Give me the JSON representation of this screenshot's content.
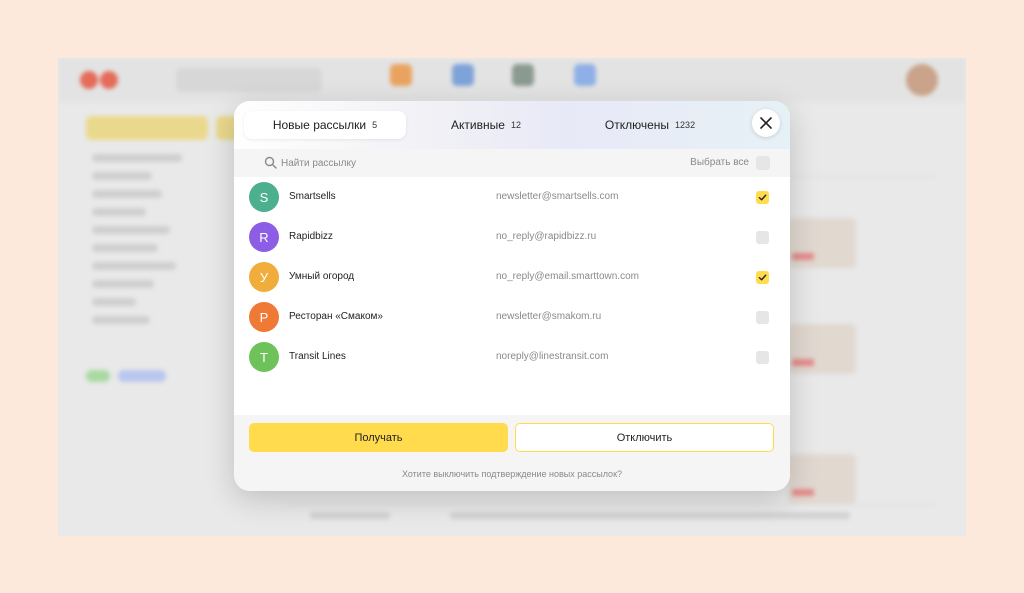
{
  "colors": {
    "page_bg": "#fde9db",
    "accent": "#ffdb4d",
    "muted_text": "#8a8a8a",
    "avatar_teal": "#4caf8e",
    "avatar_purple": "#8e5de6",
    "avatar_orange": "#f0ad3c",
    "avatar_red_orange": "#ee7a35",
    "avatar_green": "#6dc35a"
  },
  "modal": {
    "tabs": [
      {
        "label": "Новые рассылки",
        "count": "5",
        "active": true
      },
      {
        "label": "Активные",
        "count": "12",
        "active": false
      },
      {
        "label": "Отключены",
        "count": "1232",
        "active": false
      }
    ],
    "close_icon": "close-icon",
    "search": {
      "placeholder": "Найти рассылку",
      "icon": "search-icon"
    },
    "select_all_label": "Выбрать все",
    "items": [
      {
        "initial": "S",
        "name": "Smartsells",
        "email": "newsletter@smartsells.com",
        "color": "#4caf8e",
        "checked": true
      },
      {
        "initial": "R",
        "name": "Rapidbizz",
        "email": "no_reply@rapidbizz.ru",
        "color": "#8e5de6",
        "checked": false
      },
      {
        "initial": "У",
        "name": "Умный огород",
        "email": "no_reply@email.smarttown.com",
        "color": "#f0ad3c",
        "checked": true
      },
      {
        "initial": "Р",
        "name": "Ресторан «Смаком»",
        "email": "newsletter@smakom.ru",
        "color": "#ee7a35",
        "checked": false
      },
      {
        "initial": "T",
        "name": "Transit Lines",
        "email": "noreply@linestransit.com",
        "color": "#6dc35a",
        "checked": false
      }
    ],
    "footer": {
      "get_label": "Получать",
      "disable_label": "Отключить",
      "link_text": "Хотите выключить подтверждение новых рассылок?"
    }
  }
}
